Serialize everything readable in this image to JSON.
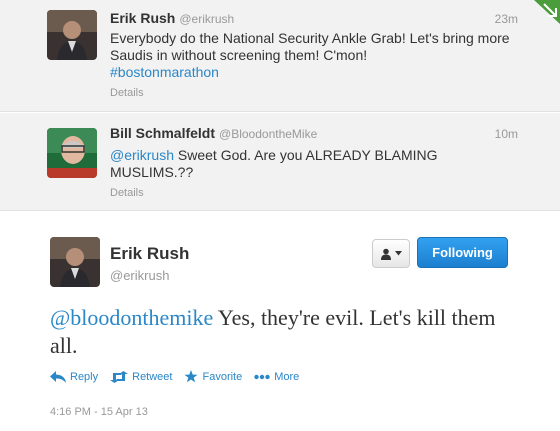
{
  "replies": [
    {
      "name": "Erik Rush",
      "handle": "@erikrush",
      "time": "23m",
      "text_main": "Everybody do the National Security Ankle Grab! Let's bring more Saudis in without screening them! C'mon!",
      "hashtag": "#bostonmarathon",
      "details": "Details"
    },
    {
      "name": "Bill Schmalfeldt",
      "handle": "@BloodontheMike",
      "time": "10m",
      "mention": "@erikrush",
      "text_main": " Sweet God. Are you ALREADY BLAMING MUSLIMS.??",
      "details": "Details"
    }
  ],
  "main": {
    "name": "Erik Rush",
    "handle": "@erikrush",
    "follow_label": "Following",
    "mention": "@bloodonthemike",
    "text": " Yes, they're evil. Let's kill them all.",
    "actions": {
      "reply": "Reply",
      "retweet": "Retweet",
      "favorite": "Favorite",
      "more": "More"
    },
    "timestamp": "4:16 PM - 15 Apr 13"
  },
  "icons": {
    "reply": "reply-arrow-icon",
    "retweet": "retweet-icon",
    "favorite": "star-icon",
    "more": "more-dots-icon",
    "user": "user-icon",
    "corner": "corner-arrow-icon"
  },
  "colors": {
    "link": "#2a87c8",
    "follow_button": "#2b90df",
    "reply_background": "#f2f2f2",
    "corner_icon": "#4a9d3a"
  }
}
